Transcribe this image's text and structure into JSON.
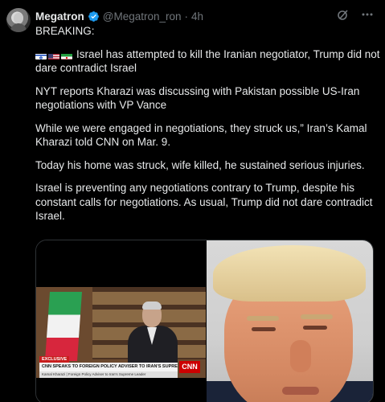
{
  "post": {
    "author_name": "Megatron",
    "handle": "@Megatron_ron",
    "separator": "·",
    "time": "4h",
    "paragraphs": [
      [
        "BREAKING:"
      ],
      [
        "Israel has attempted to kill the Iranian negotiator, Trump did not",
        "dare contradict Israel"
      ],
      [
        "NYT reports Kharazi was discussing with Pakistan possible US-Iran",
        "negotiations with VP Vance"
      ],
      [
        "While we were engaged in negotiations, they struck us,” Iran’s Kamal",
        "Kharazi told CNN on Mar. 9."
      ],
      [
        "Today his home was struck, wife killed, he sustained serious injuries."
      ],
      [
        "Israel is preventing any negotiations contrary to Trump, despite his",
        "constant calls for negotiations. As usual, Trump did not dare contradict",
        "Israel."
      ]
    ],
    "flags": [
      "israel-flag",
      "us-flag",
      "iran-flag"
    ]
  },
  "media": {
    "left_image": {
      "exclusive_label": "EXCLUSIVE",
      "headline": "CNN SPEAKS TO FOREIGN POLICY ADVISER TO IRAN'S SUPREME LEADER",
      "subline": "Kamal Kharazi | Foreign Policy Adviser to Iran's Supreme Leader",
      "network_logo": "CNN"
    }
  },
  "icons": {
    "verified": "verified-badge-icon",
    "grok": "grok-icon",
    "more": "more-options-icon"
  },
  "colors": {
    "background": "#000000",
    "text": "#e7e9ea",
    "muted": "#71767b",
    "verified": "#1d9bf0",
    "border": "#2f3336"
  }
}
